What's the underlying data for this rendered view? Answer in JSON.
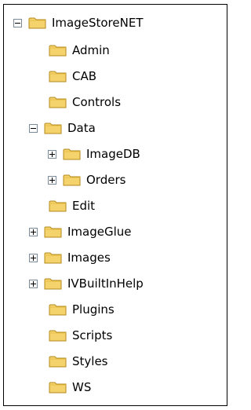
{
  "tree": {
    "root": {
      "label": "ImageStoreNET",
      "state": "expanded"
    },
    "admin": {
      "label": "Admin"
    },
    "cab": {
      "label": "CAB"
    },
    "controls": {
      "label": "Controls"
    },
    "data": {
      "label": "Data",
      "state": "expanded"
    },
    "imagedb": {
      "label": "ImageDB",
      "state": "collapsed"
    },
    "orders": {
      "label": "Orders",
      "state": "collapsed"
    },
    "edit": {
      "label": "Edit"
    },
    "imageglue": {
      "label": "ImageGlue",
      "state": "collapsed"
    },
    "images": {
      "label": "Images",
      "state": "collapsed"
    },
    "ivbuiltinhelp": {
      "label": "IVBuiltInHelp",
      "state": "collapsed"
    },
    "plugins": {
      "label": "Plugins"
    },
    "scripts": {
      "label": "Scripts"
    },
    "styles": {
      "label": "Styles"
    },
    "ws": {
      "label": "WS"
    }
  },
  "colors": {
    "folder_fill": "#f4d26c",
    "folder_tab": "#e8bd44",
    "folder_stroke": "#b38a1c",
    "toggle_border": "#7a8a99"
  },
  "icons": {
    "folder": "folder-icon",
    "expand": "plus-box-icon",
    "collapse": "minus-box-icon"
  }
}
